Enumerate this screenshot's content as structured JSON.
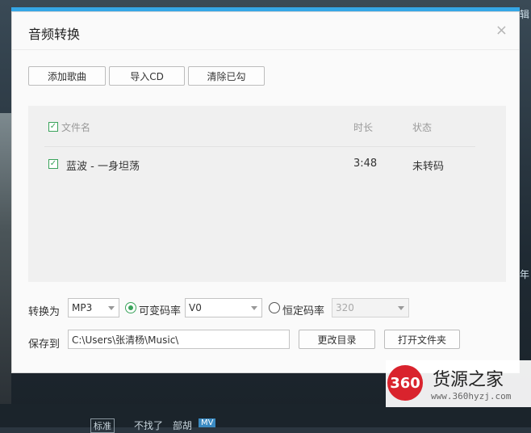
{
  "dialog": {
    "title": "音频转换",
    "close_glyph": "×",
    "toolbar": {
      "add_song": "添加歌曲",
      "import_cd": "导入CD",
      "clear_checked": "清除已勾"
    },
    "list": {
      "columns": [
        "文件名",
        "时长",
        "状态"
      ],
      "header_checked": true,
      "rows": [
        {
          "checked": true,
          "filename": "蓝波 - 一身坦荡",
          "duration": "3:48",
          "status": "未转码"
        }
      ]
    },
    "convert": {
      "label": "转换为",
      "format": "MP3",
      "vbr_label": "可变码率",
      "vbr_selected": true,
      "vbr_value": "V0",
      "cbr_label": "恒定码率",
      "cbr_selected": false,
      "cbr_value": "320"
    },
    "save": {
      "label": "保存到",
      "path": "C:\\Users\\张清杨\\Music\\",
      "change_dir": "更改目录",
      "open_folder": "打开文件夹"
    }
  },
  "watermark": {
    "logo_text": "360",
    "title": "货源之家",
    "url": "www.360hyzj.com"
  },
  "background": {
    "right_texts": [
      "辑",
      "年"
    ],
    "bottom_texts": [
      "标准",
      "不找了",
      "部胡",
      "MV"
    ]
  },
  "colors": {
    "accent_bar": "#35a7e6",
    "check_green": "#3aa35b",
    "logo_red": "#d9232d"
  }
}
